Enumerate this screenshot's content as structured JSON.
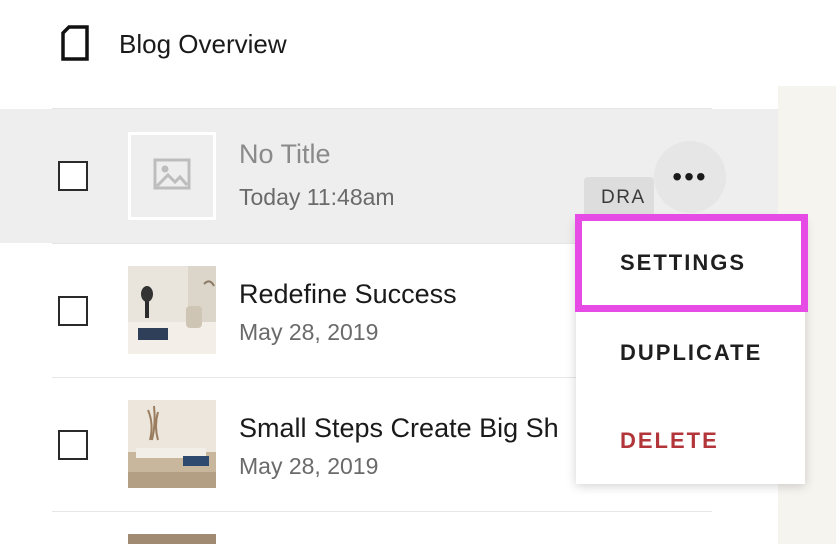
{
  "header": {
    "title": "Blog Overview",
    "icon": "page-icon"
  },
  "posts": [
    {
      "title": "No Title",
      "date": "Today 11:48am",
      "status": "DRA",
      "thumbnail": "image-placeholder-icon",
      "selected": true
    },
    {
      "title": "Redefine Success",
      "date": "May 28, 2019",
      "thumbnail": "desk-photo"
    },
    {
      "title": "Small Steps Create Big Sh",
      "date": "May 28, 2019",
      "thumbnail": "workspace-photo"
    }
  ],
  "more_button": {
    "label": "•••",
    "icon": "more-icon"
  },
  "context_menu": {
    "items": [
      {
        "label": "SETTINGS",
        "highlighted": true
      },
      {
        "label": "DUPLICATE"
      },
      {
        "label": "DELETE",
        "color": "#b2353a"
      }
    ]
  },
  "colors": {
    "highlight": "#e64be6",
    "delete": "#b2353a",
    "selected_row": "#eeeeee"
  }
}
